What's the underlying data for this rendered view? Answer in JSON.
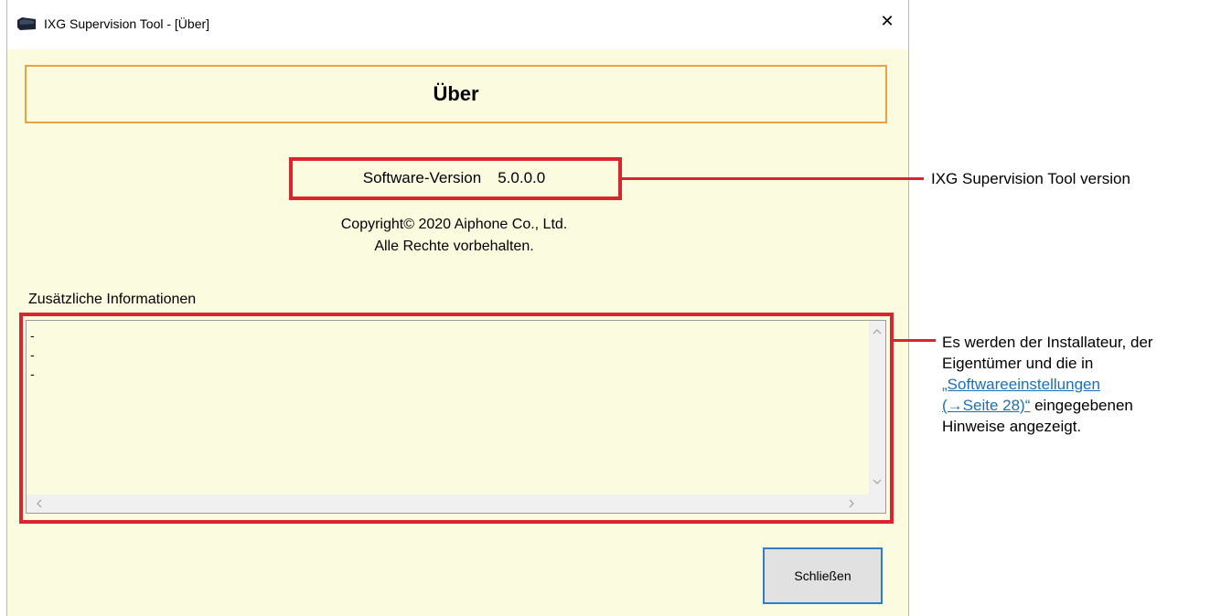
{
  "window": {
    "title": "IXG Supervision Tool - [Über]",
    "close_glyph": "✕"
  },
  "dialog": {
    "header_title": "Über",
    "version_label": "Software-Version",
    "version_value": "5.0.0.0",
    "copyright_line1": "Copyright© 2020 Aiphone Co., Ltd.",
    "copyright_line2": "Alle Rechte vorbehalten.",
    "info_label": "Zusätzliche Informationen",
    "info_lines": [
      "-",
      "-",
      "-"
    ],
    "close_button_label": "Schließen"
  },
  "annotations": {
    "version_callout": "IXG Supervision Tool version",
    "info_callout_line1": "Es werden der Installateur, der",
    "info_callout_line2": "Eigentümer und die in",
    "info_callout_link_part1": "„Softwareeinstellungen",
    "info_callout_link_part2": "(→Seite 28)“",
    "info_callout_after_link": " eingegebenen",
    "info_callout_line5": "Hinweise angezeigt."
  },
  "colors": {
    "dialog_background": "#fbfbe0",
    "header_border": "#f0a040",
    "highlight_red": "#d8262f",
    "button_focus_border": "#2f7ec7",
    "link": "#1d6fb8"
  },
  "icons": [
    "app-icon",
    "close-icon",
    "scroll-up-icon",
    "scroll-down-icon",
    "scroll-left-icon",
    "scroll-right-icon"
  ]
}
